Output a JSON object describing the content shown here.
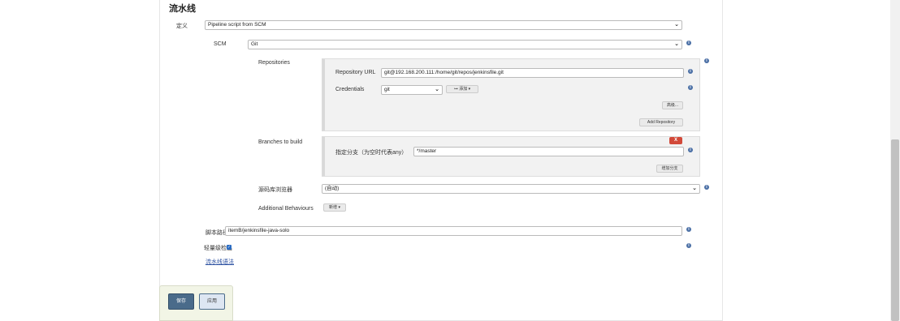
{
  "section_title": "流水线",
  "definition": {
    "label": "定义",
    "value": "Pipeline script from SCM"
  },
  "scm": {
    "label": "SCM",
    "value": "Git"
  },
  "repositories": {
    "label": "Repositories",
    "url_label": "Repository URL",
    "url_value": "git@192.168.200.111:/home/git/repos/jenkinsfile.git",
    "credentials_label": "Credentials",
    "credentials_value": "git",
    "add_button": "添加",
    "advanced_button": "高级...",
    "add_repository_button": "Add Repository"
  },
  "branches": {
    "label": "Branches to build",
    "remove_button": "X",
    "specifier_label": "指定分支（为空时代表any）",
    "specifier_value": "*/master",
    "add_branch_button": "增加分支"
  },
  "repo_browser": {
    "label": "源码库浏览器",
    "value": "(自动)"
  },
  "additional_behaviours": {
    "label": "Additional Behaviours",
    "button": "新增"
  },
  "script_path": {
    "label": "脚本路径",
    "value": "itemB/jenkinsfile-java-solo"
  },
  "lightweight_checkout": {
    "label": "轻量级检出",
    "checked": true
  },
  "pipeline_syntax_link": "流水线语法",
  "actions": {
    "save": "保存",
    "apply": "应用"
  },
  "icons": {
    "help": "help-icon",
    "dropdown": "chevron-down-icon",
    "checkbox": "checkbox-checked-icon"
  },
  "colors": {
    "help_icon": "#4a6fa5",
    "delete_button": "#d24939",
    "save_button": "#4a6b8a",
    "link": "#2a4fa0"
  }
}
